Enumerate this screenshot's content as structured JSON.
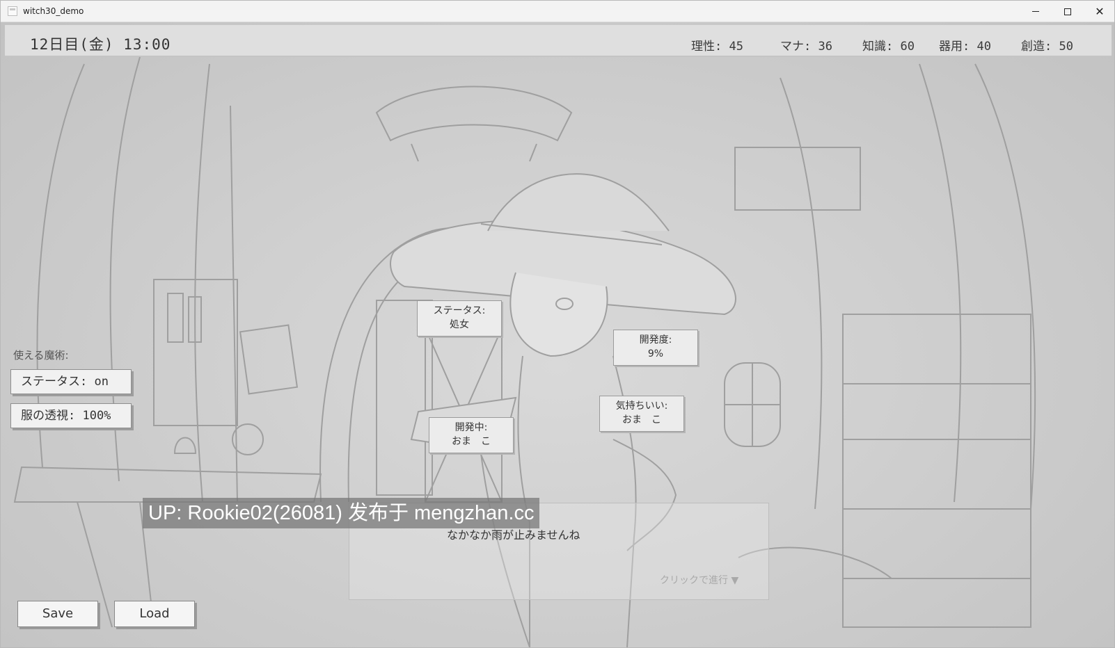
{
  "window": {
    "title": "witch30_demo",
    "minimize_glyph": "—",
    "maximize_glyph": "□",
    "close_glyph": "✕"
  },
  "hud": {
    "datetime": "12日目(金) 13:00",
    "stats": [
      {
        "label": "理性: 45"
      },
      {
        "label": "マナ: 36"
      },
      {
        "label": "知識: 60"
      },
      {
        "label": "器用: 40"
      },
      {
        "label": "創造: 50"
      }
    ]
  },
  "tags": {
    "status": {
      "line1": "ステータス:",
      "line2": "処女"
    },
    "development": {
      "line1": "開発度:",
      "line2": "9%"
    },
    "feels_good": {
      "line1": "気持ちいい:",
      "line2": "おま　こ"
    },
    "in_development": {
      "line1": "開発中:",
      "line2": "おま　こ"
    }
  },
  "spells": {
    "label": "使える魔術:",
    "items": [
      {
        "label": "ステータス: on"
      },
      {
        "label": "服の透視: 100%"
      }
    ]
  },
  "dialog": {
    "text": "なかなか雨が止みませんね",
    "hint": "クリックで進行 ▼"
  },
  "watermark": "UP: Rookie02(26081) 发布于 mengzhan.cc",
  "buttons": {
    "save": "Save",
    "load": "Load"
  }
}
